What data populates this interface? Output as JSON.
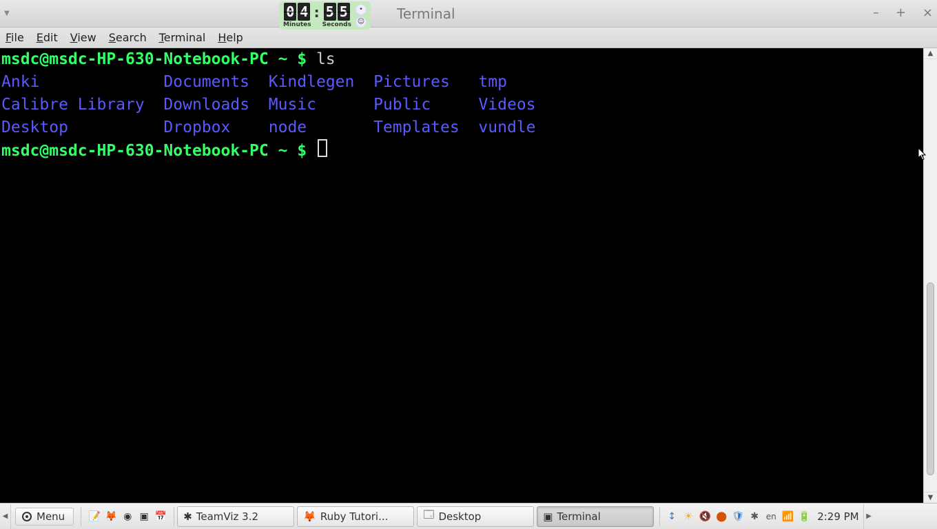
{
  "window": {
    "title": "Terminal",
    "controls": {
      "min": "–",
      "max": "+",
      "close": "×"
    }
  },
  "timer": {
    "minutes_tens": "0",
    "minutes_ones": "4",
    "seconds_tens": "5",
    "seconds_ones": "5",
    "label_minutes": "Minutes",
    "label_seconds": "Seconds"
  },
  "menubar": {
    "items": [
      "File",
      "Edit",
      "View",
      "Search",
      "Terminal",
      "Help"
    ]
  },
  "terminal": {
    "prompt": "msdc@msdc-HP-630-Notebook-PC ~ $",
    "command": "ls",
    "listing": [
      [
        "Anki",
        "Documents",
        "Kindlegen",
        "Pictures",
        "tmp"
      ],
      [
        "Calibre Library",
        "Downloads",
        "Music",
        "Public",
        "Videos"
      ],
      [
        "Desktop",
        "Dropbox",
        "node",
        "Templates",
        "vundle"
      ]
    ]
  },
  "taskbar": {
    "menu_label": "Menu",
    "quicklaunch": [
      {
        "name": "notes-icon",
        "glyph": "📝"
      },
      {
        "name": "firefox-icon",
        "glyph": "🦊"
      },
      {
        "name": "music-icon",
        "glyph": "◉"
      },
      {
        "name": "terminal-icon",
        "glyph": "▣"
      },
      {
        "name": "calendar-icon",
        "glyph": "📅"
      }
    ],
    "windows": [
      {
        "name": "teamviz",
        "icon": "✱",
        "label": "TeamViz 3.2",
        "active": false
      },
      {
        "name": "firefox",
        "icon": "🦊",
        "label": "Ruby Tutori...",
        "active": false
      },
      {
        "name": "desktop",
        "icon": "🗔",
        "label": "Desktop",
        "active": false
      },
      {
        "name": "terminal",
        "icon": "▣",
        "label": "Terminal",
        "active": true
      }
    ],
    "tray": {
      "dropbox": "↕",
      "weather": "☀",
      "mute": "🔇",
      "network": "⬤",
      "shield": "🛡",
      "bluetooth": "✱",
      "lang": "en",
      "cellular": "📶",
      "battery": "🔋"
    },
    "clock": "2:29 PM"
  }
}
